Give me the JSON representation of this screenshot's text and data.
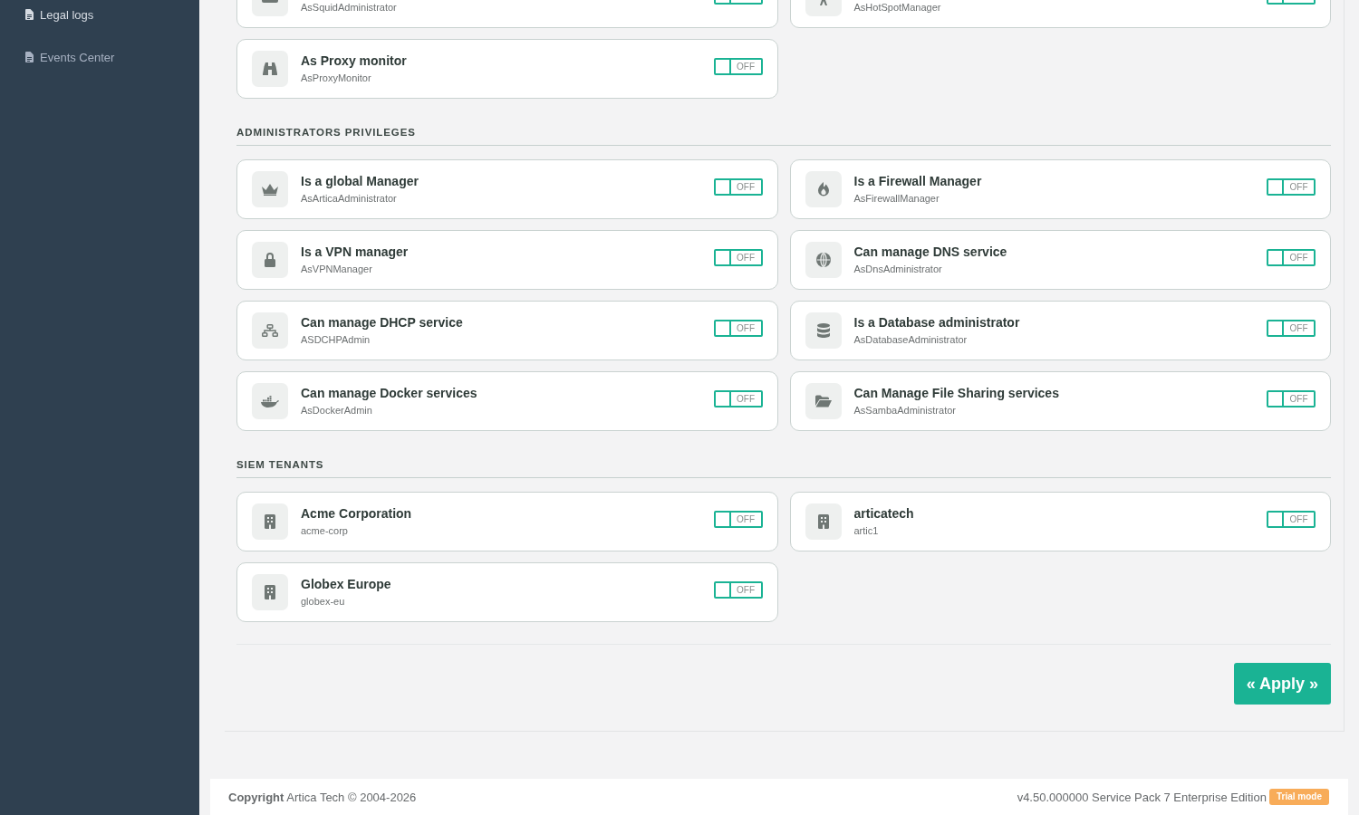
{
  "sidebar": {
    "items": [
      {
        "label": "Legal logs",
        "selected": true
      },
      {
        "label": "Events Center",
        "selected": false
      }
    ]
  },
  "sections": [
    {
      "items": [
        {
          "subtitle": "AsSquidAdministrator",
          "on": false
        },
        {
          "subtitle": "AsHotSpotManager",
          "on": false
        },
        {
          "title": "As Proxy monitor",
          "subtitle": "AsProxyMonitor",
          "on": false,
          "state_label": "OFF"
        }
      ]
    },
    {
      "heading": "ADMINISTRATORS PRIVILEGES",
      "items": [
        {
          "title": "Is a global Manager",
          "subtitle": "AsArticaAdministrator",
          "on": false,
          "state_label": "OFF"
        },
        {
          "title": "Is a Firewall Manager",
          "subtitle": "AsFirewallManager",
          "on": false,
          "state_label": "OFF"
        },
        {
          "title": "Is a VPN manager",
          "subtitle": "AsVPNManager",
          "on": false,
          "state_label": "OFF"
        },
        {
          "title": "Can manage DNS service",
          "subtitle": "AsDnsAdministrator",
          "on": false,
          "state_label": "OFF"
        },
        {
          "title": "Can manage DHCP service",
          "subtitle": "ASDCHPAdmin",
          "on": false,
          "state_label": "OFF"
        },
        {
          "title": "Is a Database administrator",
          "subtitle": "AsDatabaseAdministrator",
          "on": false,
          "state_label": "OFF"
        },
        {
          "title": "Can manage Docker services",
          "subtitle": "AsDockerAdmin",
          "on": false,
          "state_label": "OFF"
        },
        {
          "title": "Can Manage File Sharing services",
          "subtitle": "AsSambaAdministrator",
          "on": false,
          "state_label": "OFF"
        }
      ]
    },
    {
      "heading": "SIEM TENANTS",
      "items": [
        {
          "title": "Acme Corporation",
          "subtitle": "acme-corp",
          "on": false,
          "state_label": "OFF"
        },
        {
          "title": "articatech",
          "subtitle": "artic1",
          "on": false,
          "state_label": "OFF"
        },
        {
          "title": "Globex Europe",
          "subtitle": "globex-eu",
          "on": false,
          "state_label": "OFF"
        }
      ]
    }
  ],
  "apply_button": {
    "label": "« Apply »"
  },
  "footer": {
    "copyright": "**Copyright** Artica Tech © 2004-2026",
    "version": "v4.50.000000 Service Pack 7 Enterprise Edition",
    "badge": "Trial mode"
  }
}
